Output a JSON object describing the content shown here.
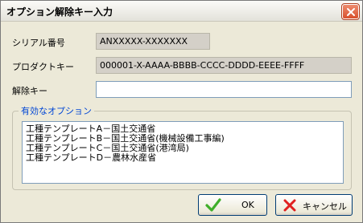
{
  "window": {
    "title": "オプション解除キー入力"
  },
  "serial": {
    "label": "シリアル番号",
    "value": "ANXXXXX-XXXXXXX"
  },
  "product_key": {
    "label": "プロダクトキー",
    "value": "000001-X-AAAA-BBBB-CCCC-DDDD-EEEE-FFFF"
  },
  "unlock_key": {
    "label": "解除キー",
    "value": ""
  },
  "options": {
    "legend": "有効なオプション",
    "items": [
      "工種テンプレートA－国土交通省",
      "工種テンプレートB－国土交通省(機械設備工事編)",
      "工種テンプレートC－国土交通省(港湾局)",
      "工種テンプレートD－農林水産省"
    ]
  },
  "buttons": {
    "ok_label": "OK",
    "cancel_label": "キャンセル"
  },
  "icons": {
    "close": "close-icon",
    "ok": "checkmark-icon",
    "cancel": "cross-icon"
  },
  "colors": {
    "close_button": "#d8502d",
    "legend_text": "#0046d5",
    "ok_check": "#3fae2a",
    "cancel_cross": "#e02020"
  }
}
